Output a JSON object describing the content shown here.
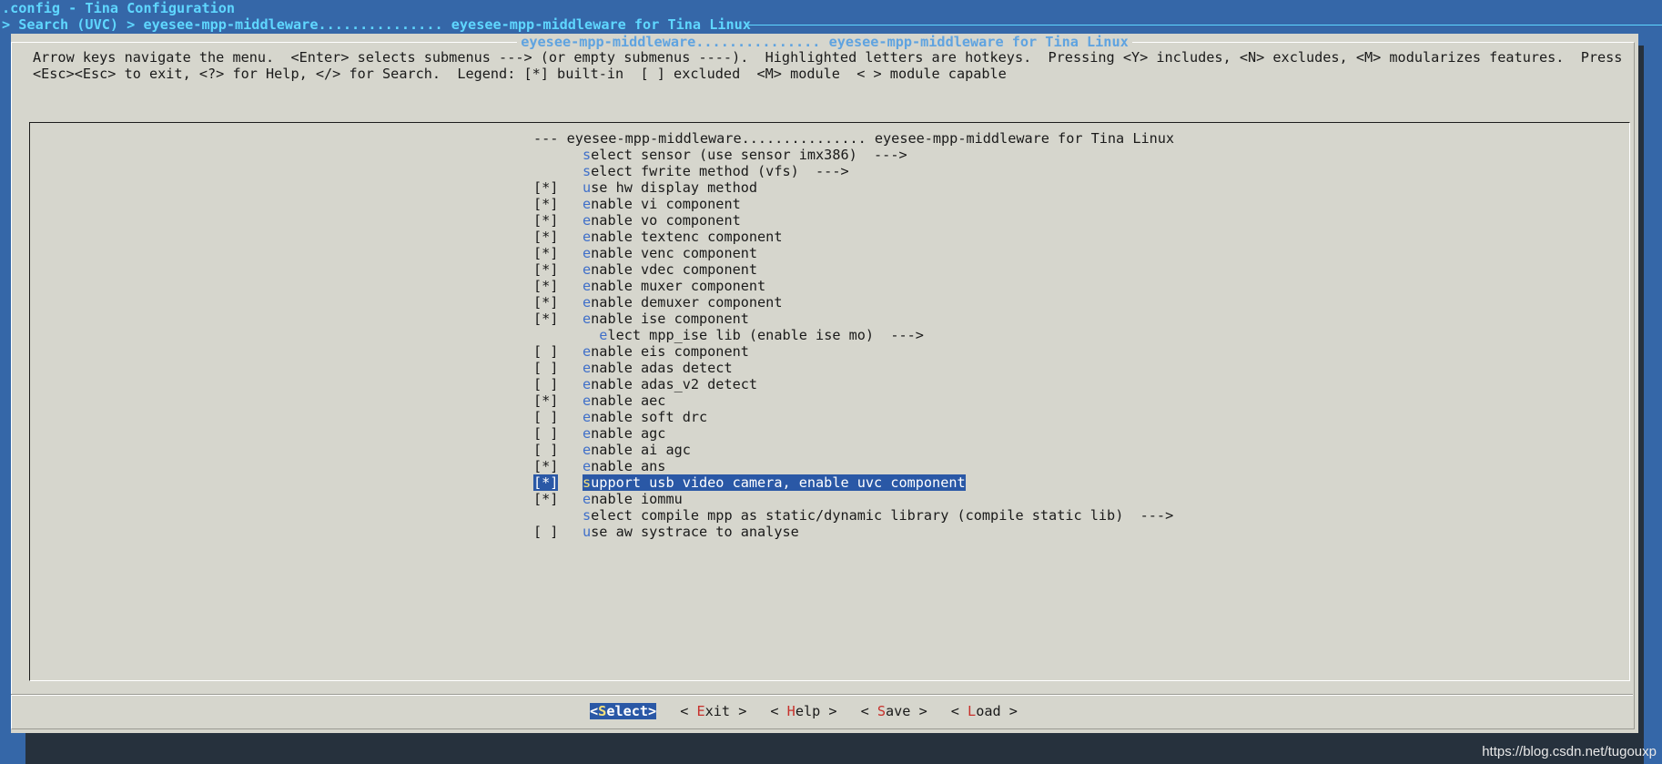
{
  "topbar": {
    "config_title": ".config - Tina Configuration",
    "breadcrumb": "> Search (UVC) > eyesee-mpp-middleware............... eyesee-mpp-middleware for Tina Linux"
  },
  "dialog": {
    "title": "eyesee-mpp-middleware............... eyesee-mpp-middleware for Tina Linux",
    "help_line1": "Arrow keys navigate the menu.  <Enter> selects submenus ---> (or empty submenus ----).  Highlighted letters are hotkeys.  Pressing <Y> includes, <N> excludes, <M> modularizes features.  Press",
    "help_line2": "<Esc><Esc> to exit, <?> for Help, </> for Search.  Legend: [*] built-in  [ ] excluded  <M> module  < > module capable"
  },
  "menu": {
    "header": "--- eyesee-mpp-middleware............... eyesee-mpp-middleware for Tina Linux",
    "items": [
      {
        "mark": "",
        "hotkey": "s",
        "rest": "elect sensor (use sensor imx386)  --->"
      },
      {
        "mark": "",
        "hotkey": "s",
        "rest": "elect fwrite method (vfs)  --->"
      },
      {
        "mark": "[*]",
        "hotkey": "u",
        "rest": "se hw display method"
      },
      {
        "mark": "[*]",
        "hotkey": "e",
        "rest": "nable vi component"
      },
      {
        "mark": "[*]",
        "hotkey": "e",
        "rest": "nable vo component"
      },
      {
        "mark": "[*]",
        "hotkey": "e",
        "rest": "nable textenc component"
      },
      {
        "mark": "[*]",
        "hotkey": "e",
        "rest": "nable venc component"
      },
      {
        "mark": "[*]",
        "hotkey": "e",
        "rest": "nable vdec component"
      },
      {
        "mark": "[*]",
        "hotkey": "e",
        "rest": "nable muxer component"
      },
      {
        "mark": "[*]",
        "hotkey": "e",
        "rest": "nable demuxer component"
      },
      {
        "mark": "[*]",
        "hotkey": "e",
        "rest": "nable ise component"
      },
      {
        "mark": "",
        "indent": "  ",
        "hotkey": "e",
        "rest": "lect mpp_ise lib (enable ise mo)  --->"
      },
      {
        "mark": "[ ]",
        "hotkey": "e",
        "rest": "nable eis component"
      },
      {
        "mark": "[ ]",
        "hotkey": "e",
        "rest": "nable adas detect"
      },
      {
        "mark": "[ ]",
        "hotkey": "e",
        "rest": "nable adas_v2 detect"
      },
      {
        "mark": "[*]",
        "hotkey": "e",
        "rest": "nable aec"
      },
      {
        "mark": "[ ]",
        "hotkey": "e",
        "rest": "nable soft drc"
      },
      {
        "mark": "[ ]",
        "hotkey": "e",
        "rest": "nable agc"
      },
      {
        "mark": "[ ]",
        "hotkey": "e",
        "rest": "nable ai agc"
      },
      {
        "mark": "[*]",
        "hotkey": "e",
        "rest": "nable ans"
      },
      {
        "mark": "[*]",
        "hotkey": "s",
        "rest": "upport usb video camera, enable uvc component",
        "selected": true
      },
      {
        "mark": "[*]",
        "hotkey": "e",
        "rest": "nable iommu"
      },
      {
        "mark": "",
        "hotkey": "s",
        "rest": "elect compile mpp as static/dynamic library (compile static lib)  --->"
      },
      {
        "mark": "[ ]",
        "hotkey": "u",
        "rest": "se aw systrace to analyse"
      }
    ]
  },
  "buttons": [
    {
      "pre": "<",
      "hotkey": "S",
      "rest": "elect",
      "post": ">",
      "active": true
    },
    {
      "pre": "< ",
      "hotkey": "E",
      "rest": "xit",
      "post": " >"
    },
    {
      "pre": "< ",
      "hotkey": "H",
      "rest": "elp",
      "post": " >"
    },
    {
      "pre": "< ",
      "hotkey": "S",
      "rest": "ave",
      "post": " >"
    },
    {
      "pre": "< ",
      "hotkey": "L",
      "rest": "oad",
      "post": " >"
    }
  ],
  "watermark": "https://blog.csdn.net/tugouxp",
  "colors": {
    "background": "#3567a8",
    "dialog": "#d6d6cd",
    "selection": "#2a58a6",
    "hotkey_menu": "#3f6fc9",
    "hotkey_button": "#c7302b",
    "title_cyan": "#5fd7ff"
  }
}
